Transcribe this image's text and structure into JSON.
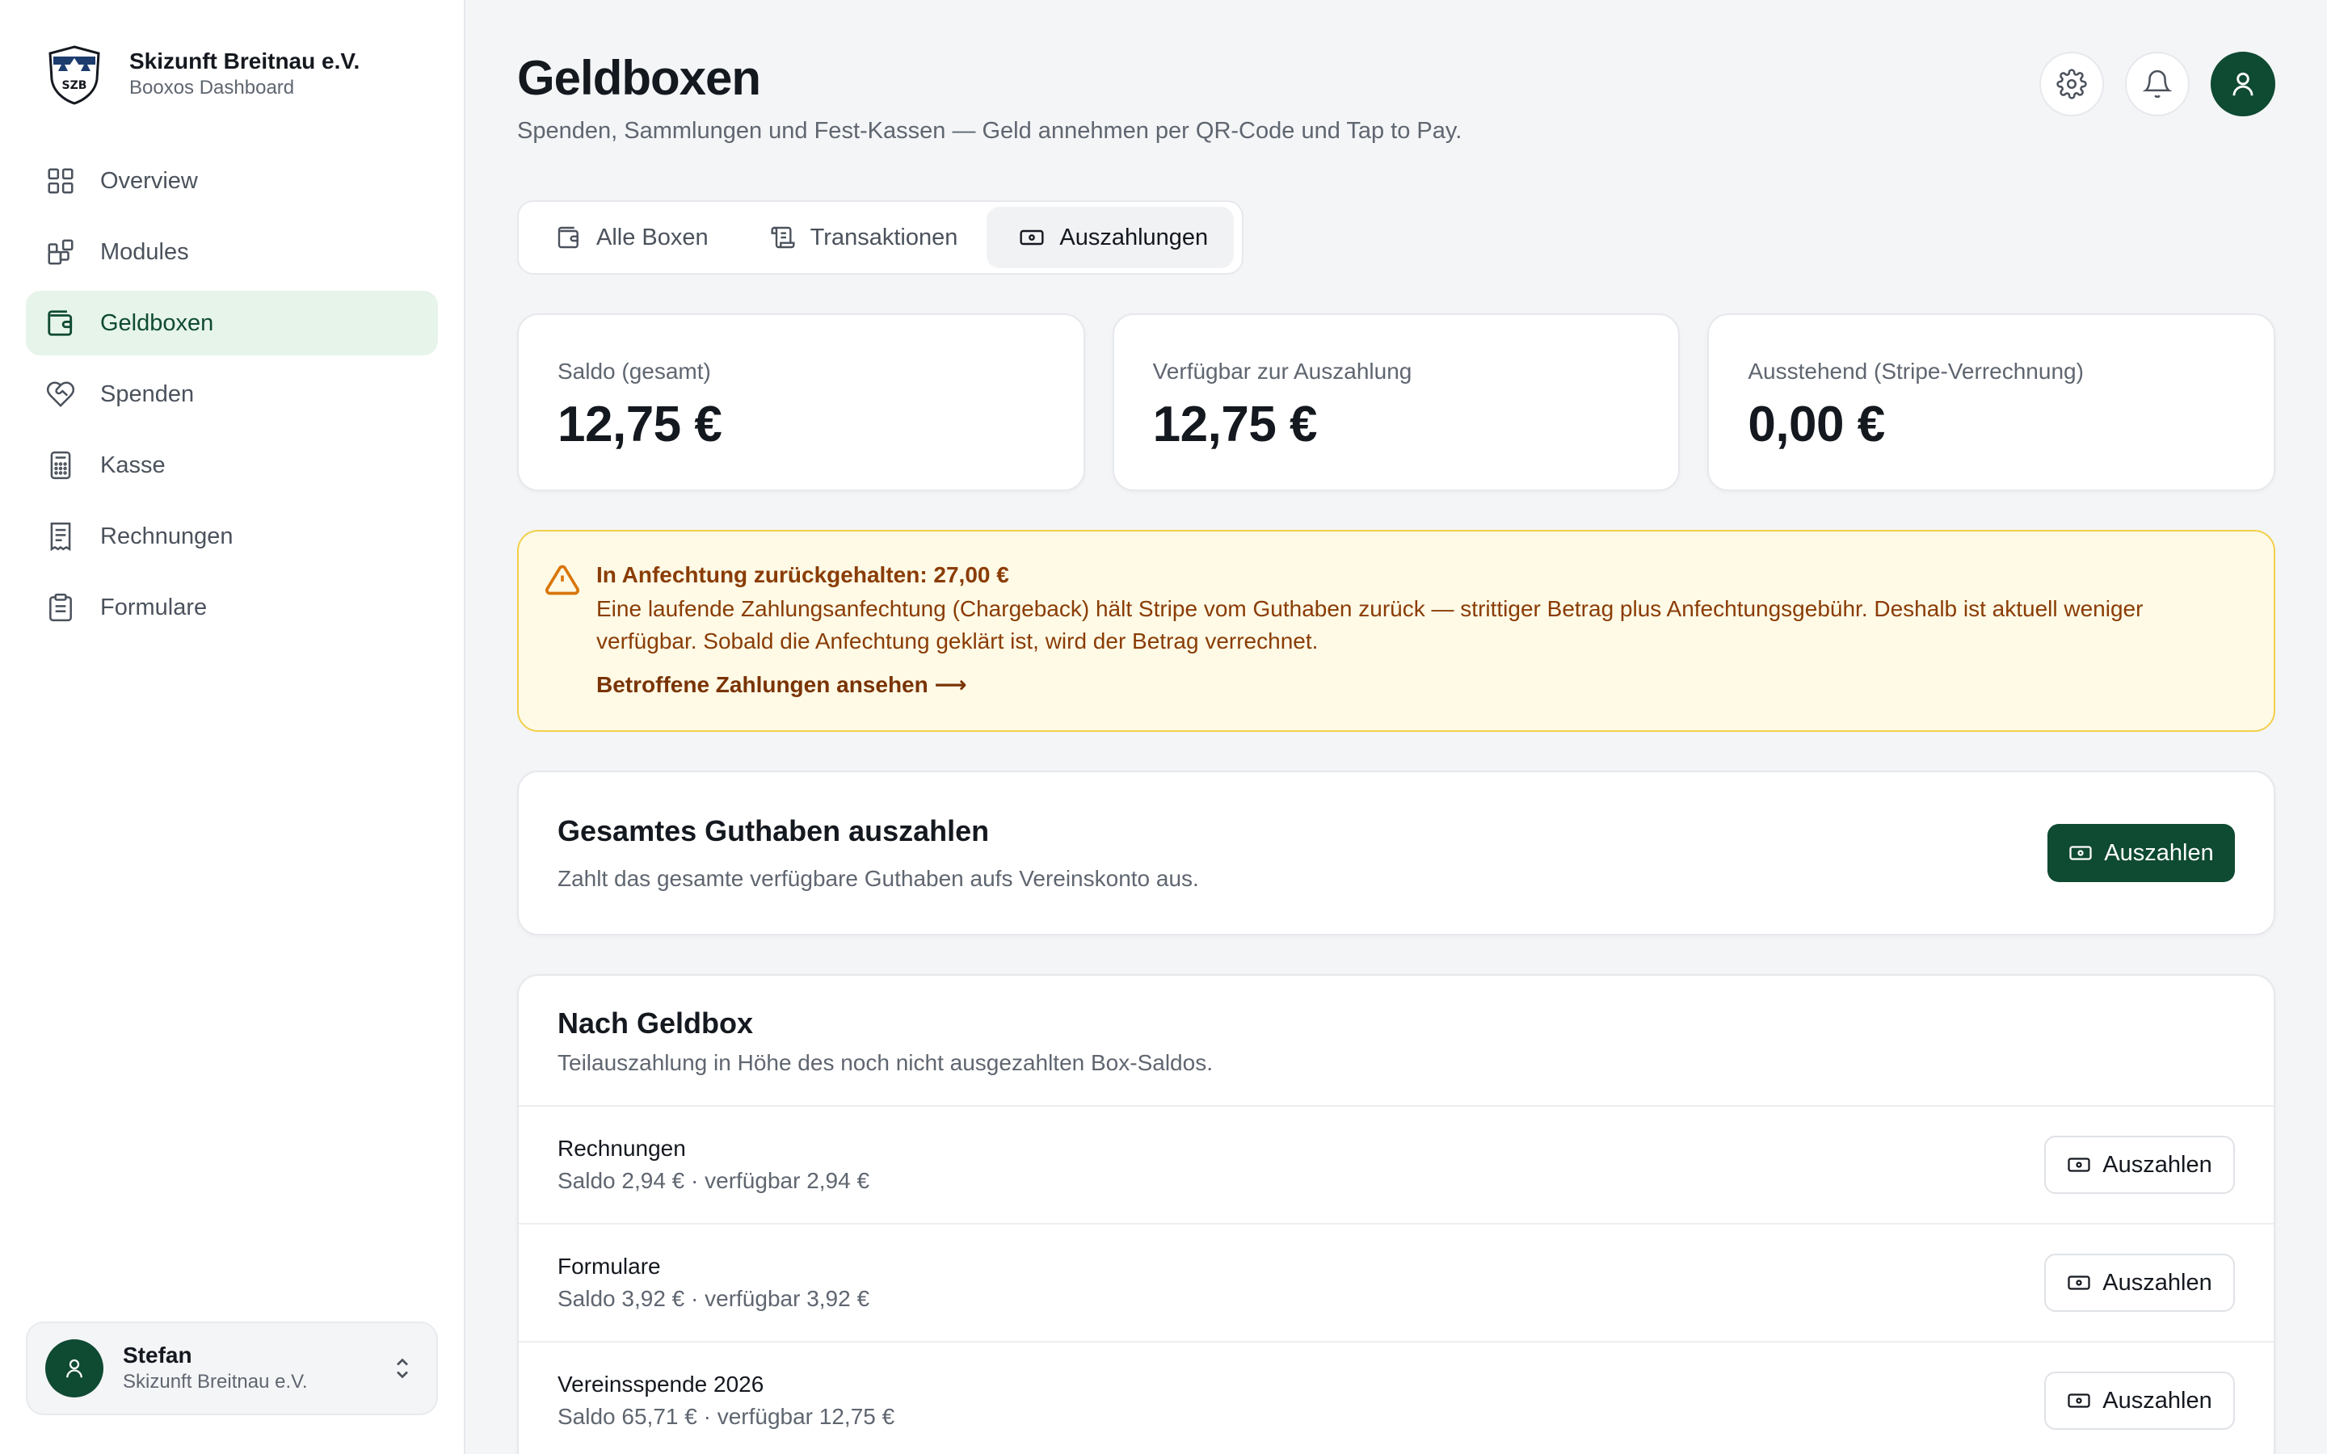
{
  "brand": {
    "name": "Skizunft Breitnau e.V.",
    "subtitle": "Booxos Dashboard",
    "logo_text": "SZB"
  },
  "sidebar": {
    "items": [
      {
        "label": "Overview",
        "icon": "grid-icon",
        "active": false
      },
      {
        "label": "Modules",
        "icon": "modules-icon",
        "active": false
      },
      {
        "label": "Geldboxen",
        "icon": "wallet-icon",
        "active": true
      },
      {
        "label": "Spenden",
        "icon": "heart-handshake-icon",
        "active": false
      },
      {
        "label": "Kasse",
        "icon": "calculator-icon",
        "active": false
      },
      {
        "label": "Rechnungen",
        "icon": "receipt-icon",
        "active": false
      },
      {
        "label": "Formulare",
        "icon": "clipboard-icon",
        "active": false
      }
    ]
  },
  "user": {
    "name": "Stefan",
    "org": "Skizunft Breitnau e.V."
  },
  "header": {
    "title": "Geldboxen",
    "subtitle": "Spenden, Sammlungen und Fest-Kassen — Geld annehmen per QR-Code und Tap to Pay."
  },
  "tabs": [
    {
      "label": "Alle Boxen",
      "icon": "wallet-icon",
      "active": false
    },
    {
      "label": "Transaktionen",
      "icon": "scroll-icon",
      "active": false
    },
    {
      "label": "Auszahlungen",
      "icon": "banknote-icon",
      "active": true
    }
  ],
  "stats": [
    {
      "label": "Saldo (gesamt)",
      "value": "12,75 €"
    },
    {
      "label": "Verfügbar zur Auszahlung",
      "value": "12,75 €"
    },
    {
      "label": "Ausstehend (Stripe-Verrechnung)",
      "value": "0,00 €"
    }
  ],
  "alert": {
    "title": "In Anfechtung zurückgehalten: 27,00 €",
    "text": "Eine laufende Zahlungsanfechtung (Chargeback) hält Stripe vom Guthaben zurück — strittiger Betrag plus Anfechtungsgebühr. Deshalb ist aktuell weniger verfügbar. Sobald die Anfechtung geklärt ist, wird der Betrag verrechnet.",
    "link": "Betroffene Zahlungen ansehen ⟶"
  },
  "payout_all": {
    "title": "Gesamtes Guthaben auszahlen",
    "description": "Zahlt das gesamte verfügbare Guthaben aufs Vereinskonto aus.",
    "button": "Auszahlen"
  },
  "by_box": {
    "title": "Nach Geldbox",
    "description": "Teilauszahlung in Höhe des noch nicht ausgezahlten Box-Saldos.",
    "rows": [
      {
        "name": "Rechnungen",
        "meta": "Saldo 2,94 € · verfügbar 2,94 €",
        "button": "Auszahlen"
      },
      {
        "name": "Formulare",
        "meta": "Saldo 3,92 € · verfügbar 3,92 €",
        "button": "Auszahlen"
      },
      {
        "name": "Vereinsspende 2026",
        "meta": "Saldo 65,71 € · verfügbar 12,75 €",
        "button": "Auszahlen"
      }
    ]
  },
  "colors": {
    "brand_green": "#0f4a32",
    "active_nav_bg": "#e6f4ea",
    "warning_bg": "#fefae6",
    "warning_border": "#f2cf4a",
    "warning_text": "#8a3c05"
  }
}
